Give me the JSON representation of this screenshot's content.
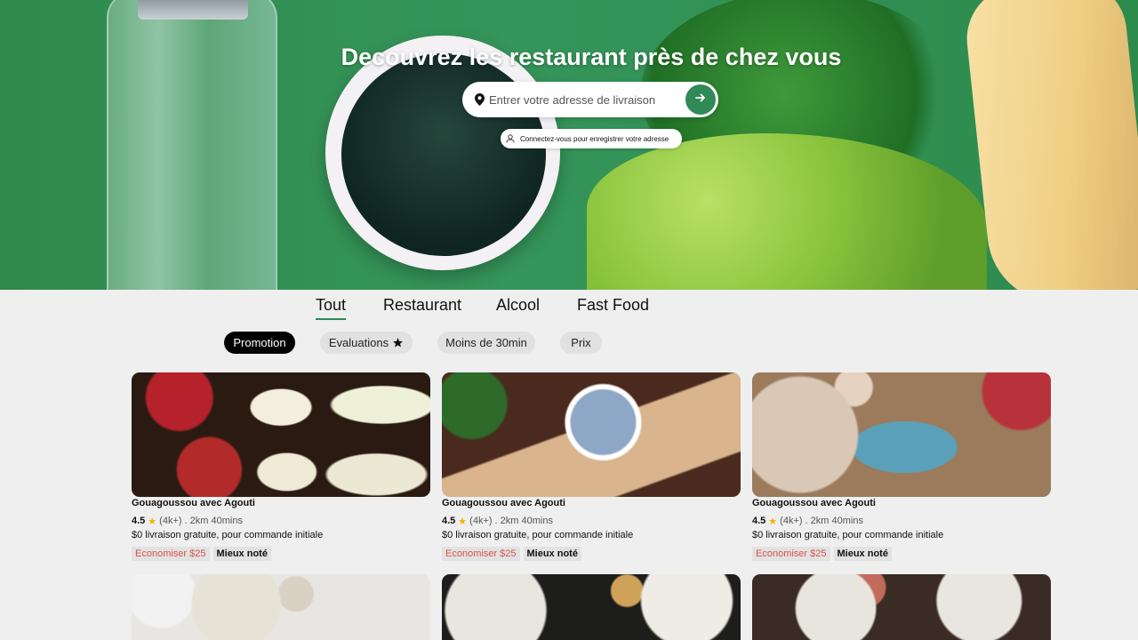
{
  "hero": {
    "title": "Decouvrez les restaurant près de chez vous",
    "search": {
      "placeholder": "Entrer votre adresse de livraison"
    },
    "login_hint": "Connectez-vous pour enregistrer votre adresse"
  },
  "tabs": [
    {
      "label": "Tout",
      "active": true
    },
    {
      "label": "Restaurant"
    },
    {
      "label": "Alcool"
    },
    {
      "label": "Fast Food"
    }
  ],
  "filters": [
    {
      "label": "Promotion",
      "active": true
    },
    {
      "label": "Evaluations"
    },
    {
      "label": "Moins de 30min"
    },
    {
      "label": "Prix"
    }
  ],
  "cards": [
    {
      "title": "Gouagoussou avec Agouti",
      "rating": "4.5",
      "reviews": "(4k+)",
      "meta": ". 2km 40mins",
      "promo": "$0 livraison gratuite, pour commande initiale",
      "badge_save": "Economiser $25",
      "badge_top": "Mieux noté"
    },
    {
      "title": "Gouagoussou avec Agouti",
      "rating": "4.5",
      "reviews": "(4k+)",
      "meta": ". 2km 40mins",
      "promo": "$0 livraison gratuite, pour commande initiale",
      "badge_save": "Economiser $25",
      "badge_top": "Mieux noté"
    },
    {
      "title": "Gouagoussou avec Agouti",
      "rating": "4.5",
      "reviews": "(4k+)",
      "meta": ". 2km 40mins",
      "promo": "$0 livraison gratuite, pour commande initiale",
      "badge_save": "Economiser $25",
      "badge_top": "Mieux noté"
    }
  ],
  "colors": {
    "accent": "#2f8a57",
    "promo_text": "#d9534f",
    "star": "#f2b400"
  },
  "icons": {
    "search_pin": "location-pin-icon",
    "go": "arrow-right-icon",
    "user": "user-icon",
    "star": "star-icon"
  }
}
